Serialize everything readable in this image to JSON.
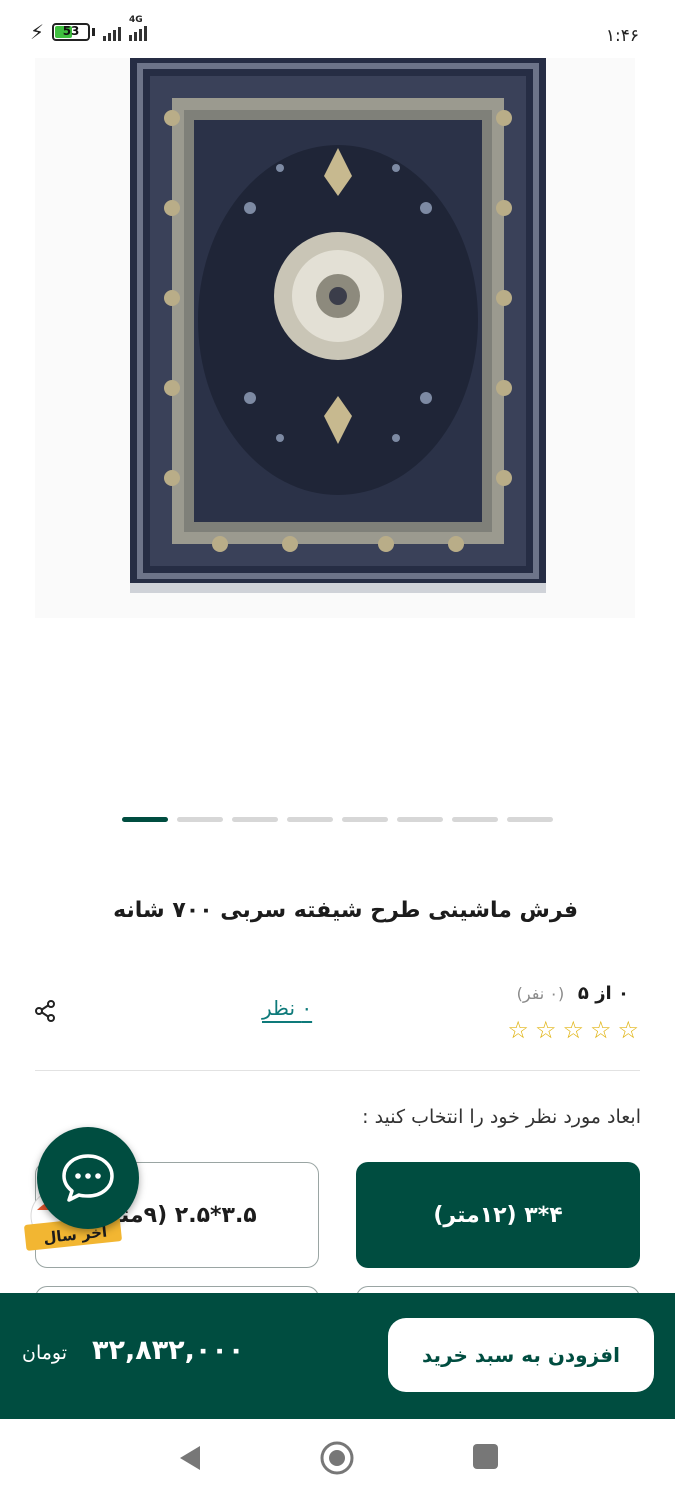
{
  "status_bar": {
    "battery": "53",
    "network": "4G",
    "time": "۱:۴۶"
  },
  "carousel": {
    "slide_count": 8,
    "active_index": 0
  },
  "product": {
    "title": "فرش ماشینی طرح شیفته سربی ۷۰۰ شانه",
    "rating_score": "۰ از ۵",
    "rating_count": "(۰ نفر)",
    "stars": 0,
    "reviews_link": "۰ نظر"
  },
  "sizes": {
    "label": "ابعاد مورد نظر خود را انتخاب کنید :",
    "options": [
      {
        "label": "۴*۳ (۱۲متر)",
        "selected": true
      },
      {
        "label": "۳.۵*۲.۵ (۹متر)",
        "selected": false
      }
    ]
  },
  "promo": {
    "text": "آخر سال"
  },
  "purchase": {
    "add_to_cart": "افزودن به سبد خرید",
    "price": "۳۲,۸۳۲,۰۰۰",
    "currency": "تومان"
  },
  "colors": {
    "primary": "#004d40",
    "star": "#e0b30f",
    "link": "#0e7a7a"
  }
}
